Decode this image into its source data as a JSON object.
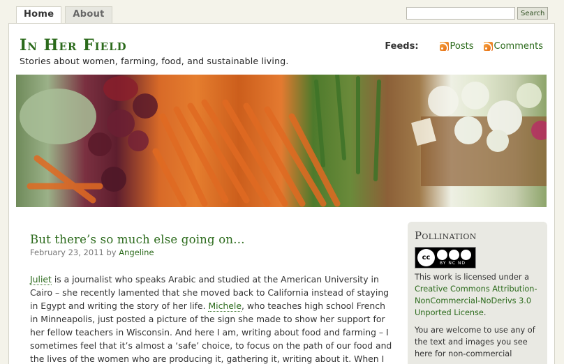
{
  "nav": {
    "tabs": [
      {
        "label": "Home",
        "active": true
      },
      {
        "label": "About",
        "active": false
      }
    ]
  },
  "search": {
    "value": "",
    "button_label": "Search"
  },
  "header": {
    "site_title": "In Her Field",
    "tagline": "Stories about women, farming, food, and sustainable living.",
    "feeds_label": "Feeds:",
    "feed_posts": "Posts",
    "feed_comments": "Comments"
  },
  "post": {
    "title": "But there’s so much else going on…",
    "date": "February 23, 2011",
    "by": "by",
    "author": "Angeline",
    "name1": "Juliet",
    "seg1": " is a journalist who speaks Arabic and studied at the American University in Cairo – she recently lamented that she moved back to California instead of staying in Egypt and writing the story of her life. ",
    "name2": "Michele",
    "seg2": ", who teaches high school French in Minneapolis, just posted a picture of the sign she made to show her support for her fellow teachers in Wisconsin. And here I am, writing about food and farming – I sometimes feel that it’s almost a ‘safe’ choice, to focus on the path of our food and the lives of the women who are producing it, gathering it, writing about it. When I"
  },
  "sidebar": {
    "title": "Pollination",
    "badge_cc": "cc",
    "badge_labels": "BY  NC  ND",
    "license_intro": "This work is licensed under a ",
    "license_link": "Creative Commons Attribution-NonCommercial-NoDerivs 3.0 Unported License",
    "license_end": ".",
    "welcome": "You are welcome to use any of the text and images you see here for non-commercial"
  }
}
